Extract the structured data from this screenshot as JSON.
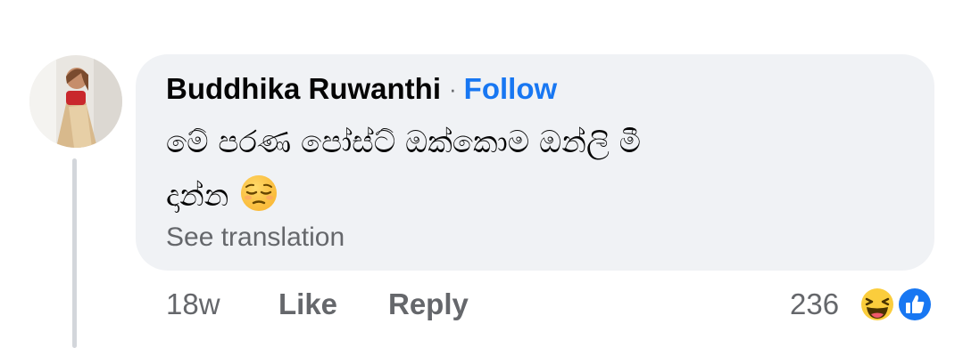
{
  "comment": {
    "author": "Buddhika Ruwanthi",
    "separator": "·",
    "follow_label": "Follow",
    "text_line1": "මේ පරණ පෝස්ට් ඔක්කොම ඔන්ලි මී",
    "text_line2": "දාන්න",
    "inline_emoji": "pensive-face-icon",
    "see_translation": "See translation",
    "timestamp": "18w",
    "like_label": "Like",
    "reply_label": "Reply",
    "reaction_count": "236",
    "reactions": [
      "haha-icon",
      "like-icon"
    ]
  },
  "colors": {
    "bubble": "#f0f2f5",
    "link_blue": "#1877f2",
    "secondary_text": "#65676b",
    "primary_text": "#050505"
  }
}
